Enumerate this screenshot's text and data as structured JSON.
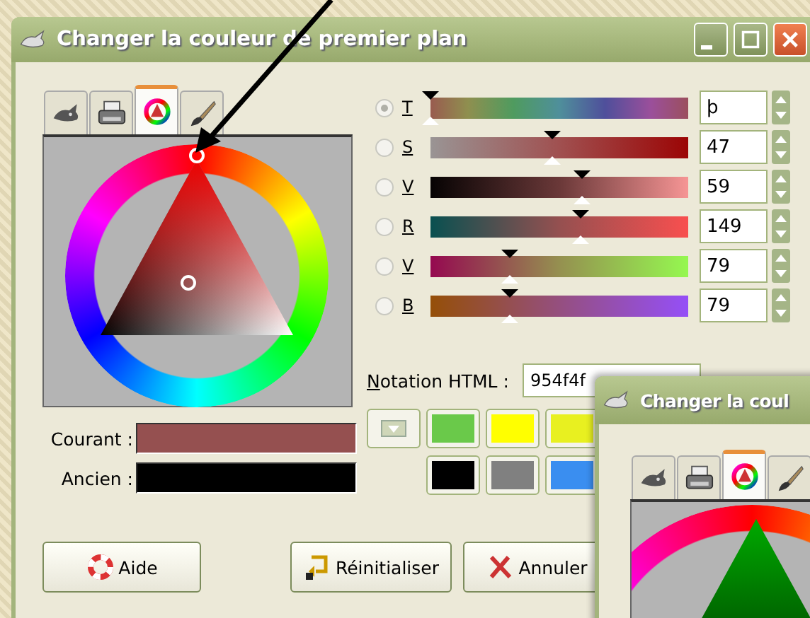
{
  "window": {
    "title": "Changer la couleur de premier plan"
  },
  "tabs": [
    {
      "kind": "mascot",
      "selected": false
    },
    {
      "kind": "printer",
      "selected": false
    },
    {
      "kind": "wheel",
      "selected": true
    },
    {
      "kind": "brush",
      "selected": false
    }
  ],
  "sliders": [
    {
      "label": "T",
      "selected": true,
      "level": 0.0,
      "value": "þ"
    },
    {
      "label": "S",
      "selected": false,
      "level": 0.47,
      "value": "47"
    },
    {
      "label": "V",
      "selected": false,
      "level": 0.59,
      "value": "59"
    },
    {
      "label": "R",
      "selected": false,
      "level": 0.58,
      "value": "149"
    },
    {
      "label": "V",
      "selected": false,
      "level": 0.31,
      "value": "79"
    },
    {
      "label": "B",
      "selected": false,
      "level": 0.31,
      "value": "79"
    }
  ],
  "html_notation": {
    "label": "Notation HTML :",
    "value": "954f4f"
  },
  "history": [
    {
      "color": "#6ac94a"
    },
    {
      "color": "#ffff00"
    },
    {
      "color": "#e8f020"
    },
    {
      "color": "#000000"
    },
    {
      "color": "#808080"
    },
    {
      "color": "#3a8ef0"
    }
  ],
  "current": {
    "label": "Courant :",
    "color": "#955050"
  },
  "old": {
    "label": "Ancien :",
    "color": "#000000"
  },
  "buttons": [
    {
      "kind": "help",
      "label": "Aide"
    },
    {
      "kind": "reset",
      "label": "Réinitialiser"
    },
    {
      "kind": "cancel",
      "label": "Annuler"
    }
  ],
  "second_window": {
    "title": "Changer la coul",
    "tabs": [
      {
        "kind": "mascot",
        "selected": false
      },
      {
        "kind": "printer",
        "selected": false
      },
      {
        "kind": "wheel",
        "selected": true
      },
      {
        "kind": "brush",
        "selected": false
      }
    ]
  }
}
